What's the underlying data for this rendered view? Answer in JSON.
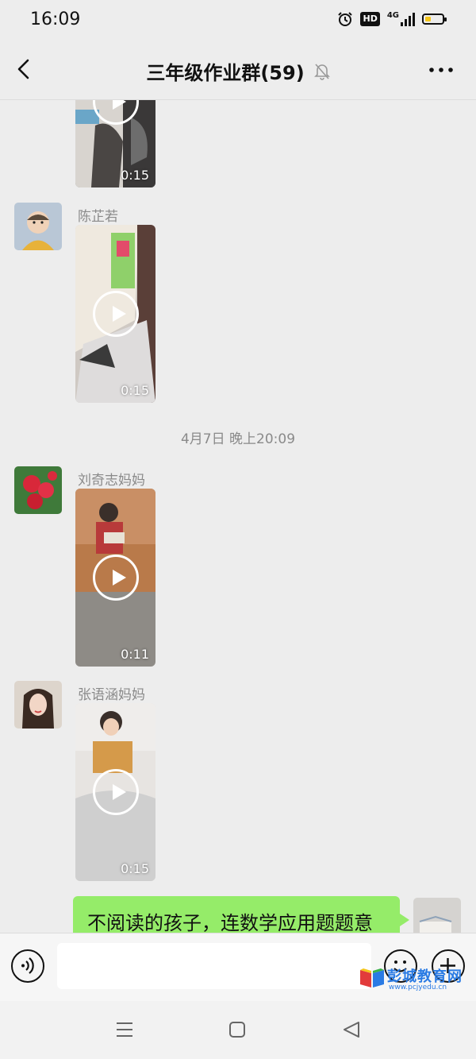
{
  "status_bar": {
    "time": "16:09",
    "hd_label": "HD",
    "network_label": "4G",
    "battery_level": 0.35,
    "icons": [
      "alarm-icon",
      "hd-icon",
      "signal-icon",
      "battery-icon"
    ]
  },
  "header": {
    "title": "三年级作业群(59)",
    "muted_icon": "bell-off-icon",
    "back_icon": "chevron-left-icon",
    "more_icon": "more-dots-icon"
  },
  "messages": [
    {
      "sender": "",
      "duration": "0:15"
    },
    {
      "sender": "陈芷若",
      "duration": "0:15"
    },
    {
      "timestamp": "4月7日 晚上20:09"
    },
    {
      "sender": "刘奇志妈妈",
      "duration": "0:11"
    },
    {
      "sender": "张语涵妈妈",
      "duration": "0:15"
    },
    {
      "sender": "me",
      "text": "不阅读的孩子，连数学应用题题意"
    }
  ],
  "input_bar": {
    "value": "",
    "voice_icon": "voice-icon",
    "emoji_icon": "emoji-icon",
    "plus_icon": "plus-icon"
  },
  "watermark": {
    "title": "彭城教育网",
    "url": "www.pcjyedu.cn"
  },
  "nav_bar": {
    "icons": [
      "menu-icon",
      "home-icon",
      "back-triangle-icon"
    ]
  },
  "colors": {
    "background": "#ededed",
    "bubble": "#95ec69",
    "watermark": "#2a7be4"
  }
}
